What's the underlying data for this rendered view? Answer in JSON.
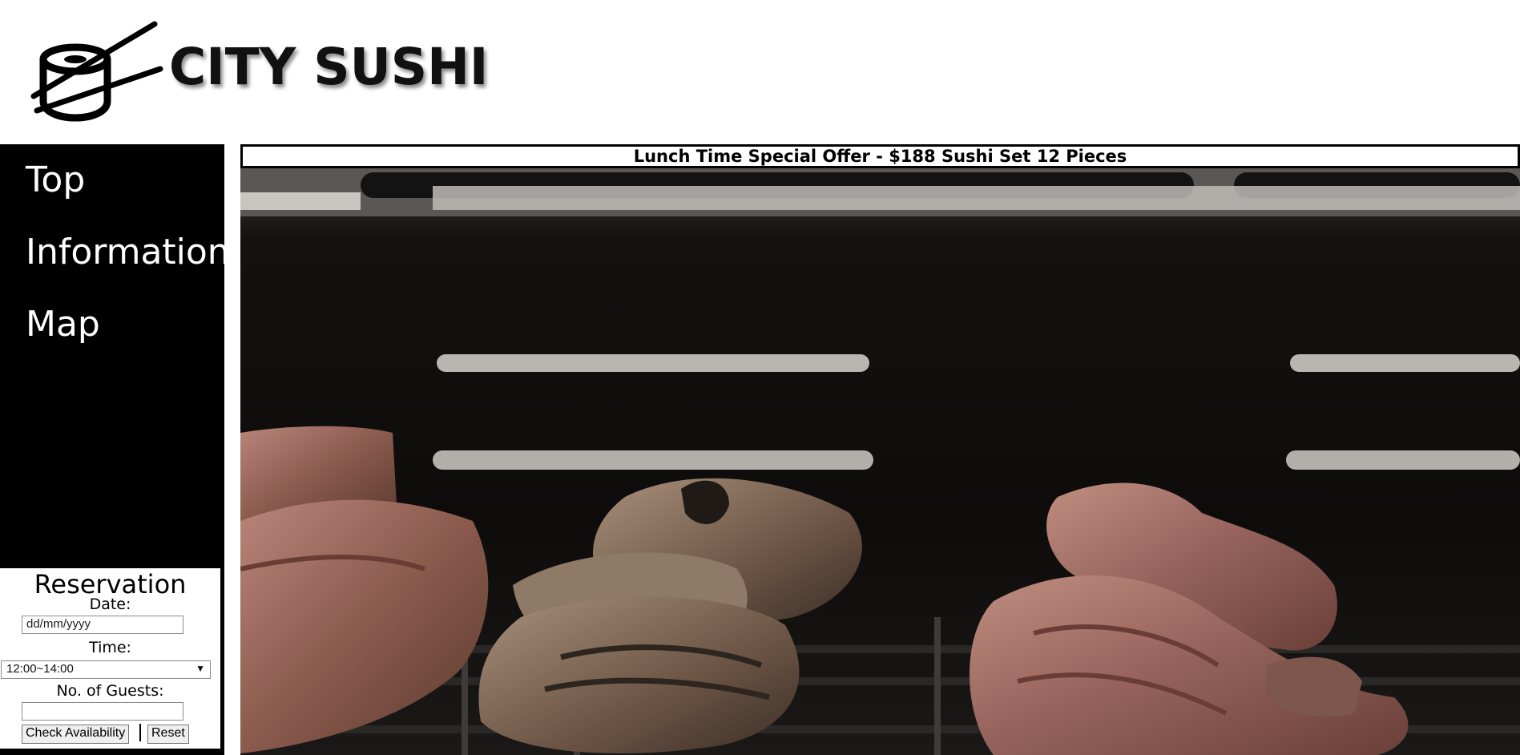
{
  "header": {
    "brand": "CITY SUSHI",
    "logo_icon": "sushi-roll-with-chopsticks-icon"
  },
  "nav": {
    "items": [
      {
        "label": "Top"
      },
      {
        "label": "Information"
      },
      {
        "label": "Map"
      }
    ]
  },
  "reservation": {
    "title": "Reservation",
    "date_label": "Date:",
    "date_placeholder": "dd/mm/yyyy",
    "time_label": "Time:",
    "time_value": "12:00~14:00",
    "guests_label": "No. of Guests:",
    "guests_value": "",
    "check_button": "Check Availability",
    "reset_button": "Reset"
  },
  "banner": {
    "text": "Lunch Time Special Offer - $188 Sushi Set 12 Pieces"
  },
  "hero": {
    "image": "grilled-meat-on-barbecue-grill"
  },
  "colors": {
    "sidebar": "#000000",
    "nav_text": "#ffffff",
    "banner_bg": "#ffffff"
  }
}
